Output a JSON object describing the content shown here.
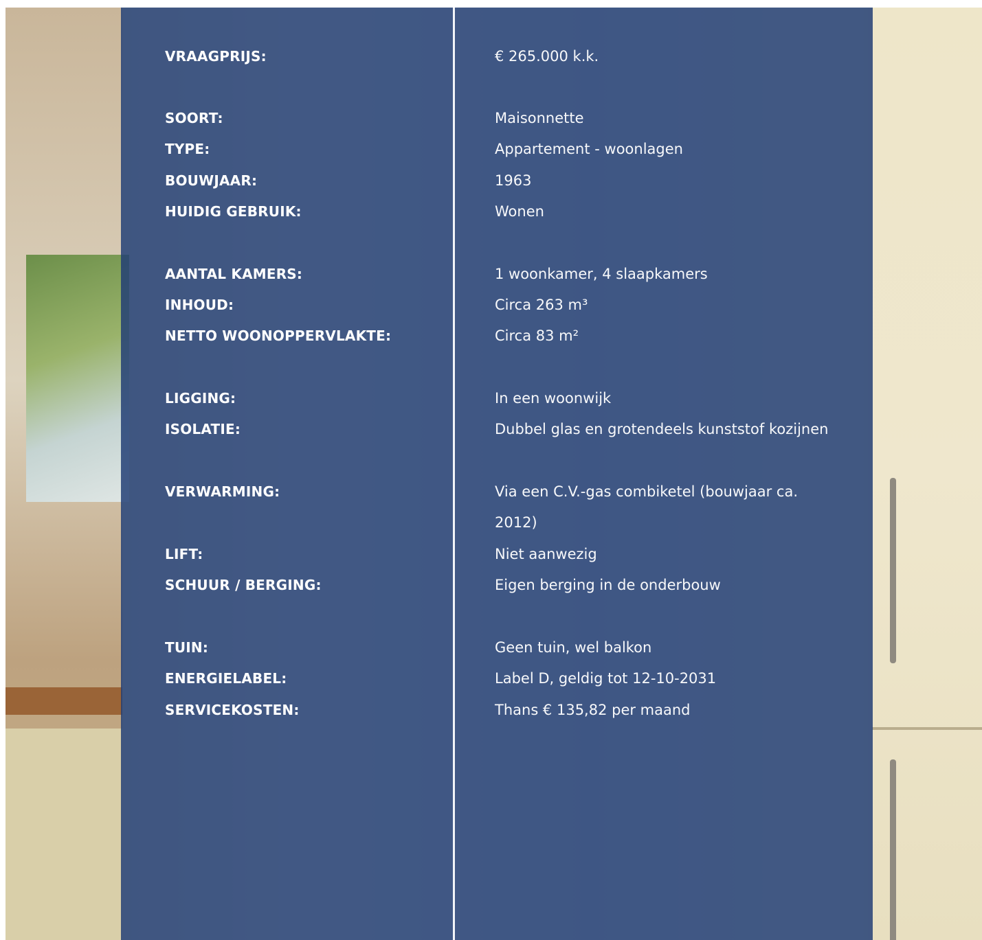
{
  "details": [
    {
      "label": "VRAAGPRIJS:",
      "value": "€ 265.000 k.k."
    },
    {
      "label": "SOORT:",
      "value": "Maisonnette"
    },
    {
      "label": "TYPE:",
      "value": "Appartement - woonlagen"
    },
    {
      "label": "BOUWJAAR:",
      "value": "1963"
    },
    {
      "label": "HUIDIG GEBRUIK:",
      "value": "Wonen"
    },
    {
      "label": "AANTAL KAMERS:",
      "value": "1 woonkamer, 4 slaapkamers"
    },
    {
      "label": "INHOUD:",
      "value": "Circa 263 m³"
    },
    {
      "label": "NETTO WOONOPPERVLAKTE:",
      "value": "Circa 83 m²"
    },
    {
      "label": "LIGGING:",
      "value": "In een woonwijk"
    },
    {
      "label": "ISOLATIE:",
      "value": "Dubbel glas en grotendeels kunststof kozijnen"
    },
    {
      "label": "VERWARMING:",
      "value": "Via een C.V.-gas combiketel (bouwjaar ca. 2012)"
    },
    {
      "label": "LIFT:",
      "value": "Niet aanwezig"
    },
    {
      "label": "SCHUUR / BERGING:",
      "value": "Eigen berging in de onderbouw"
    },
    {
      "label": "TUIN:",
      "value": "Geen tuin, wel balkon"
    },
    {
      "label": "ENERGIELABEL:",
      "value": "Label D, geldig tot 12-10-2031"
    },
    {
      "label": "SERVICEKOSTEN:",
      "value": "Thans €  135,82 per maand"
    }
  ],
  "colors": {
    "overlay": "#213e75",
    "text": "#ffffff",
    "divider": "#f2f4f8"
  }
}
